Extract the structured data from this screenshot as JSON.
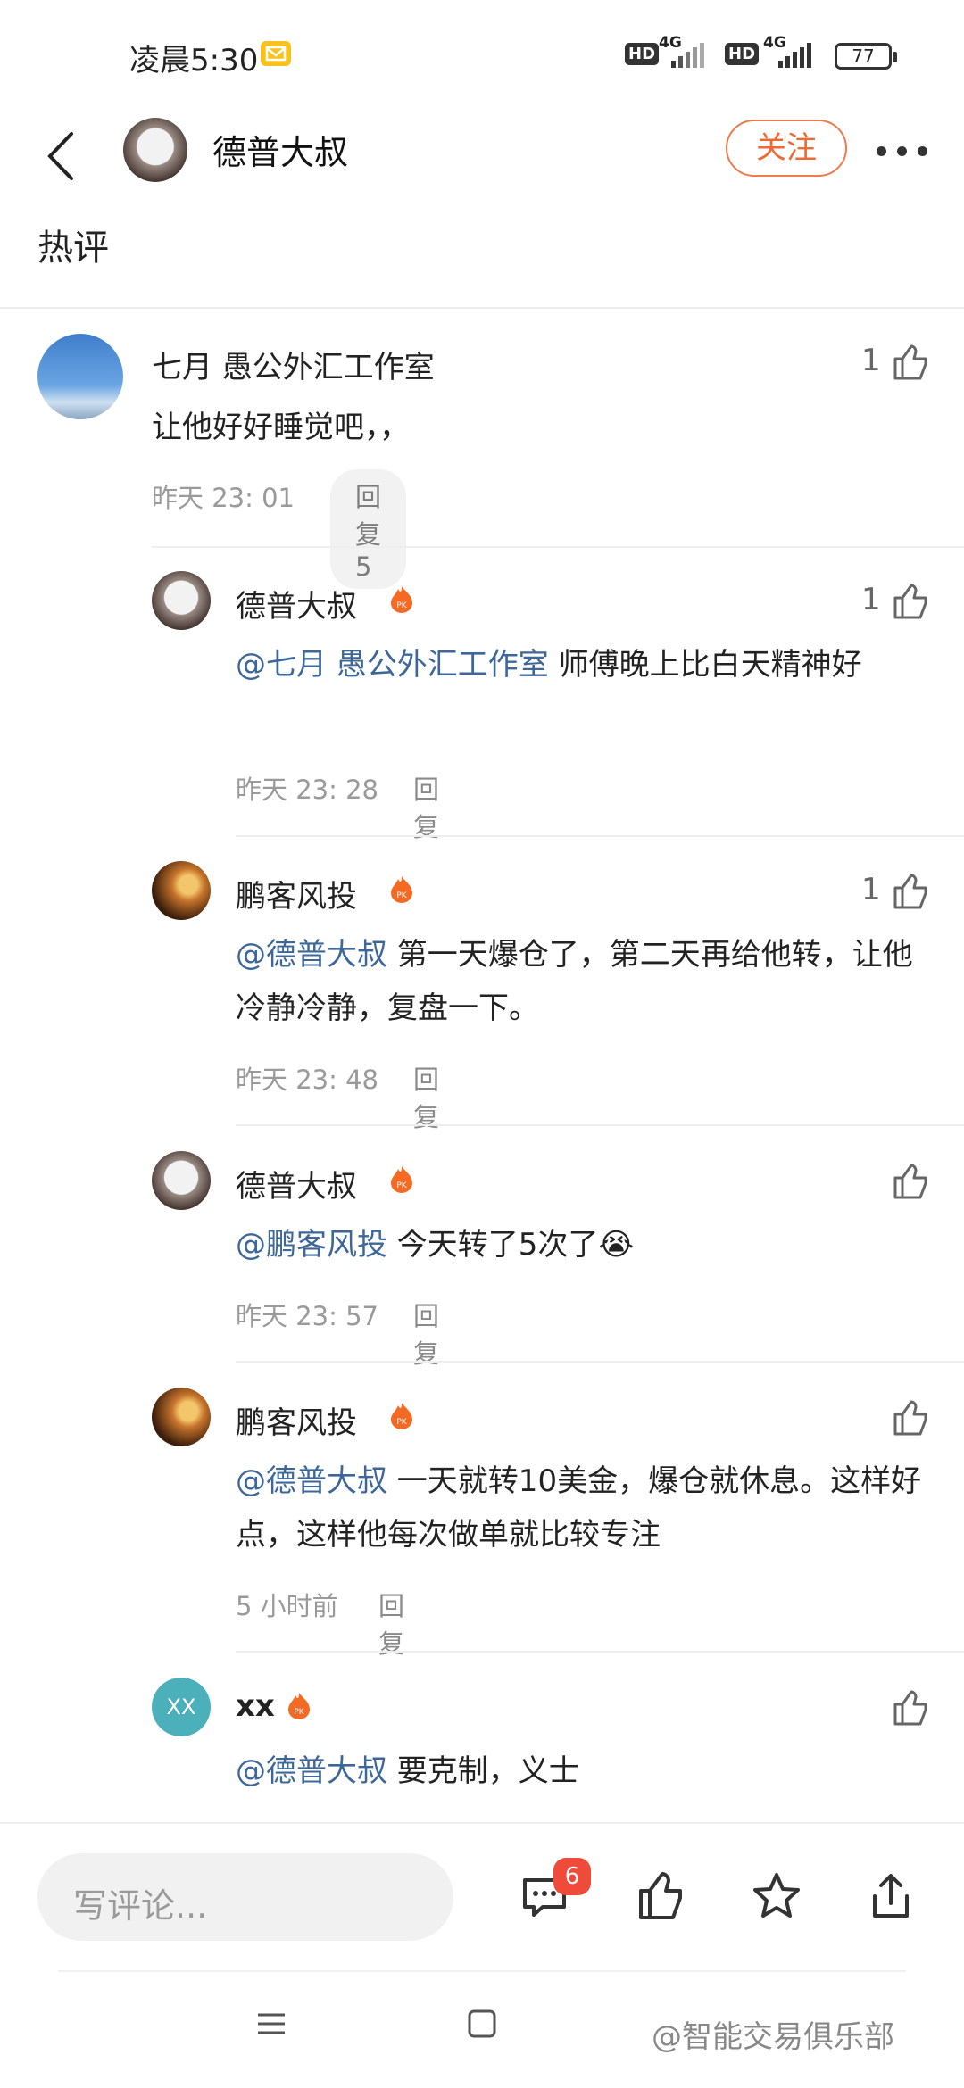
{
  "status_bar": {
    "time": "凌晨5:30",
    "network_1": "4G",
    "network_2": "4G",
    "hd_label": "HD",
    "battery": "77"
  },
  "header": {
    "title": "德普大叔",
    "follow_label": "关注"
  },
  "section": {
    "title": "热评"
  },
  "comments": [
    {
      "name": "七月 愚公外汇工作室",
      "text": "让他好好睡觉吧，，",
      "time": "昨天 23: 01",
      "reply": "回复5",
      "likes": "1"
    },
    {
      "name": "德普大叔",
      "mention": "@七月 愚公外汇工作室",
      "text": " 师傅晚上比白天精神好",
      "time": "昨天 23: 28",
      "reply": "回复",
      "likes": "1"
    },
    {
      "name": "鹏客风投",
      "mention": "@德普大叔",
      "text": " 第一天爆仓了，第二天再给他转，让他冷静冷静，复盘一下。",
      "time": "昨天 23: 48",
      "reply": "回复",
      "likes": "1"
    },
    {
      "name": "德普大叔",
      "mention": "@鹏客风投",
      "text": " 今天转了5次了😭",
      "time": "昨天 23: 57",
      "reply": "回复",
      "likes": ""
    },
    {
      "name": "鹏客风投",
      "mention": "@德普大叔",
      "text": " 一天就转10美金，爆仓就休息。这样好点，这样他每次做单就比较专注",
      "time": "5 小时前",
      "reply": "回复",
      "likes": ""
    },
    {
      "name": "xx",
      "avatar_text": "XX",
      "mention": "@德普大叔",
      "text": " 要克制，义士",
      "likes": ""
    }
  ],
  "bottom_bar": {
    "input_placeholder": "写评论...",
    "comment_badge": "6"
  },
  "watermark": "@智能交易俱乐部",
  "colors": {
    "accent": "#ef6a32",
    "mention": "#3e6799",
    "badge": "#f04a3a"
  }
}
